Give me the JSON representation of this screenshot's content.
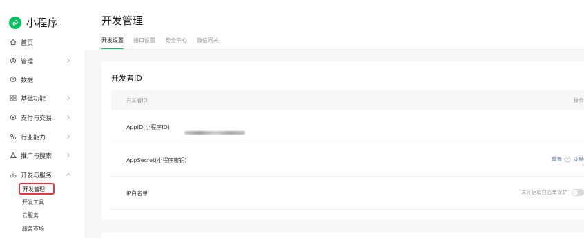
{
  "app": {
    "name": "小程序",
    "logo_icon": "mini-program-logo-icon",
    "brand_color": "#07c160"
  },
  "sidebar": {
    "items": [
      {
        "label": "首页",
        "icon": "home-icon",
        "has_arrow": false
      },
      {
        "label": "管理",
        "icon": "settings-gear-icon",
        "has_arrow": true
      },
      {
        "label": "数据",
        "icon": "clock-chart-icon",
        "has_arrow": false
      },
      {
        "label": "基础功能",
        "icon": "grid-icon",
        "has_arrow": true
      },
      {
        "label": "支付与交易",
        "icon": "target-icon",
        "has_arrow": true
      },
      {
        "label": "行业能力",
        "icon": "industry-icon",
        "has_arrow": true
      },
      {
        "label": "推广与搜索",
        "icon": "promote-icon",
        "has_arrow": true
      },
      {
        "label": "开发与服务",
        "icon": "dev-service-icon",
        "has_arrow": true,
        "expanded": true
      }
    ],
    "sub_items": [
      {
        "label": "开发管理",
        "active": true
      },
      {
        "label": "开发工具"
      },
      {
        "label": "云服务"
      },
      {
        "label": "服务市场"
      }
    ],
    "highlight_color": "#e5343e"
  },
  "header": {
    "title": "开发管理",
    "tabs": [
      {
        "label": "开发设置",
        "active": true
      },
      {
        "label": "接口设置"
      },
      {
        "label": "安全中心"
      },
      {
        "label": "微信网关"
      }
    ]
  },
  "card": {
    "title": "开发者ID",
    "table_header": {
      "left": "开发者ID",
      "right": "操作"
    },
    "rows": [
      {
        "label": "AppID(小程序ID)"
      },
      {
        "label": "AppSecret(小程序密钥)",
        "action_reset": "重置",
        "action_freeze": "冻结"
      },
      {
        "label": "IP白名单",
        "status_text": "未开启ip白名单保护",
        "toggle_on": false
      }
    ]
  },
  "colors": {
    "link": "#576b95",
    "muted": "#9a9a9a",
    "page_bg": "#f6f7f9"
  }
}
